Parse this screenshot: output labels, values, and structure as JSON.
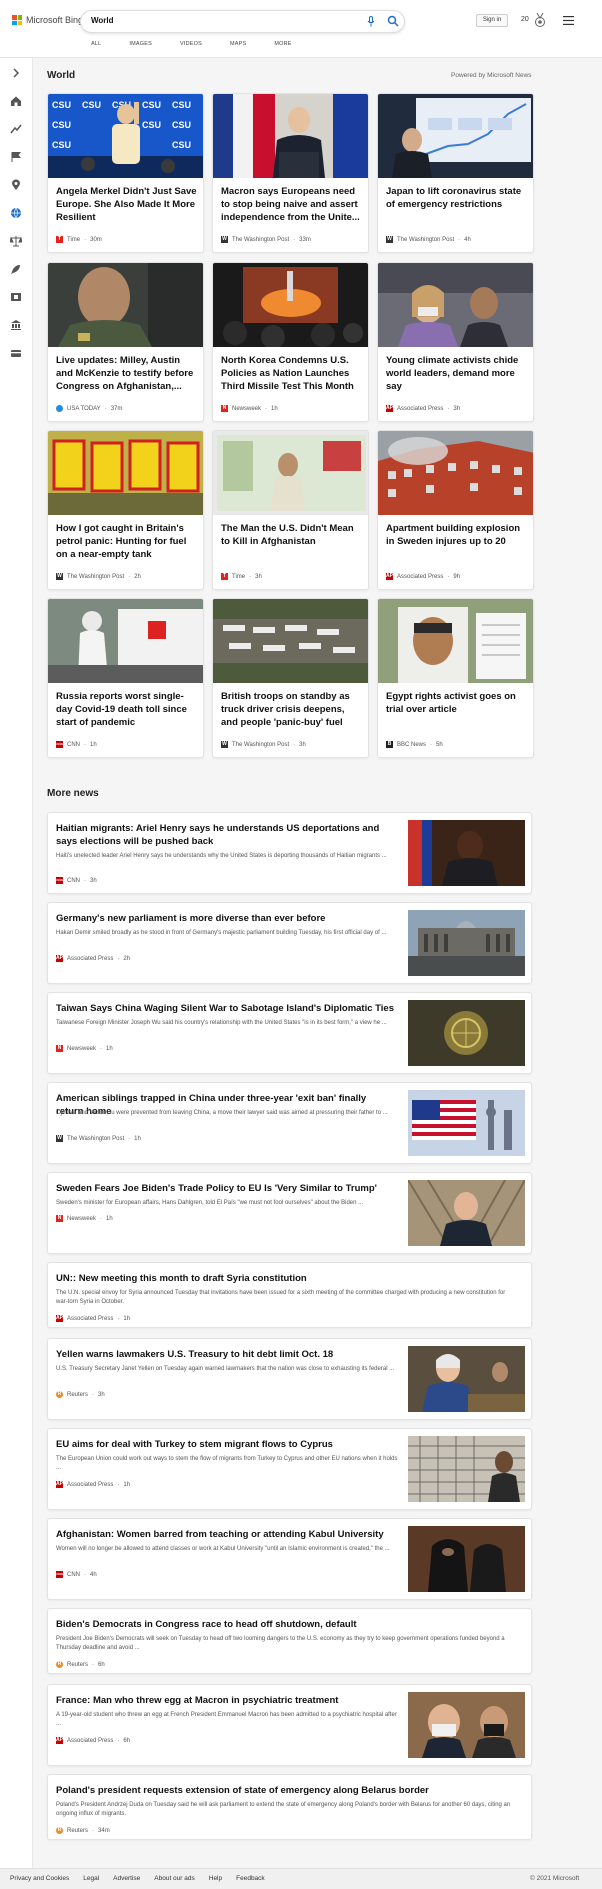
{
  "header": {
    "logo_text": "Microsoft Bing",
    "search_value": "World",
    "tabs": [
      "ALL",
      "IMAGES",
      "VIDEOS",
      "MAPS",
      "MORE"
    ],
    "signin_label": "Sign in",
    "points": "20"
  },
  "sidebar": {
    "icons": [
      "chevron-right-icon",
      "home-icon",
      "trending-icon",
      "flag-icon",
      "location-pin-icon",
      "globe-icon",
      "balance-icon",
      "rocket-icon",
      "film-icon",
      "bank-icon",
      "wallet-icon"
    ]
  },
  "world": {
    "title": "World",
    "powered_by": "Powered by Microsoft News",
    "cards": [
      {
        "title": "Angela Merkel Didn't Just Save Europe. She Also Made It More Resilient",
        "source": "Time",
        "time": "30m",
        "logo": "T",
        "logo_color": "#e2231a"
      },
      {
        "title": "Macron says Europeans need to stop being naive and assert independence from the Unite...",
        "source": "The Washington Post",
        "time": "33m",
        "logo": "W",
        "logo_color": "#333333"
      },
      {
        "title": "Japan to lift coronavirus state of emergency restrictions",
        "source": "The Washington Post",
        "time": "4h",
        "logo": "W",
        "logo_color": "#333333"
      },
      {
        "title": "Live updates: Milley, Austin and McKenzie to testify before Congress on Afghanistan,...",
        "source": "USA TODAY",
        "time": "37m",
        "logo": "●",
        "logo_color": "#1e8fe1"
      },
      {
        "title": "North Korea Condemns U.S. Policies as Nation Launches Third Missile Test This Month",
        "source": "Newsweek",
        "time": "1h",
        "logo": "N",
        "logo_color": "#e2231a"
      },
      {
        "title": "Young climate activists chide world leaders, demand more say",
        "source": "Associated Press",
        "time": "3h",
        "logo": "AP",
        "logo_color": "#cc0000"
      },
      {
        "title": "How I got caught in Britain's petrol panic: Hunting for fuel on a near-empty tank",
        "source": "The Washington Post",
        "time": "2h",
        "logo": "W",
        "logo_color": "#333333"
      },
      {
        "title": "The Man the U.S. Didn't Mean to Kill in Afghanistan",
        "source": "Time",
        "time": "3h",
        "logo": "T",
        "logo_color": "#e2231a"
      },
      {
        "title": "Apartment building explosion in Sweden injures up to 20",
        "source": "Associated Press",
        "time": "9h",
        "logo": "AP",
        "logo_color": "#cc0000"
      },
      {
        "title": "Russia reports worst single-day Covid-19 death toll since start of pandemic",
        "source": "CNN",
        "time": "1h",
        "logo": "CNN",
        "logo_color": "#cc0000"
      },
      {
        "title": "British troops on standby as truck driver crisis deepens, and people 'panic-buy' fuel",
        "source": "The Washington Post",
        "time": "3h",
        "logo": "W",
        "logo_color": "#333333"
      },
      {
        "title": "Egypt rights activist goes on trial over article",
        "source": "BBC News",
        "time": "5h",
        "logo": "B",
        "logo_color": "#222222"
      }
    ]
  },
  "more_news": {
    "title": "More news",
    "items": [
      {
        "title": "Haitian migrants: Ariel Henry says he understands US deportations and says elections will be pushed back",
        "snippet": "Haiti's unelected leader Ariel Henry says he understands why the United States is deporting thousands of Haitian migrants ...",
        "source": "CNN",
        "time": "3h",
        "logo": "CNN",
        "logo_color": "#cc0000"
      },
      {
        "title": "Germany's new parliament is more diverse than ever before",
        "snippet": "Hakan Demir smiled broadly as he stood in front of Germany's majestic parliament building Tuesday, his first official day of ...",
        "source": "Associated Press",
        "time": "2h",
        "logo": "AP",
        "logo_color": "#cc0000"
      },
      {
        "title": "Taiwan Says China Waging Silent War to Sabotage Island's Diplomatic Ties",
        "snippet": "Taiwanese Foreign Minister Joseph Wu said his country's relationship with the United States \"is in its best form,\" a view he ...",
        "source": "Newsweek",
        "time": "1h",
        "logo": "N",
        "logo_color": "#e2231a"
      },
      {
        "title": "American siblings trapped in China under three-year 'exit ban' finally return home",
        "snippet": "Cynthia and Victor Liu were prevented from leaving China, a move their lawyer said was aimed at pressuring their father to ...",
        "source": "The Washington Post",
        "time": "1h",
        "logo": "W",
        "logo_color": "#333333"
      },
      {
        "title": "Sweden Fears Joe Biden's Trade Policy to EU Is 'Very Similar to Trump'",
        "snippet": "Sweden's minister for European affairs, Hans Dahlgren, told El País \"we must not fool ourselves\" about the Biden ...",
        "source": "Newsweek",
        "time": "1h",
        "logo": "N",
        "logo_color": "#e2231a"
      },
      {
        "title": "UN:: New meeting this month to draft Syria constitution",
        "snippet": "The U.N. special envoy for Syria announced Tuesday that invitations have been issued for a sixth meeting of the committee charged with producing a new constitution for war-torn Syria in October.",
        "source": "Associated Press",
        "time": "1h",
        "logo": "AP",
        "logo_color": "#cc0000"
      },
      {
        "title": "Yellen warns lawmakers U.S. Treasury to hit debt limit Oct. 18",
        "snippet": "U.S. Treasury Secretary Janet Yellen on Tuesday again warned lawmakers that the nation was close to exhausting its federal ...",
        "source": "Reuters",
        "time": "3h",
        "logo": "R",
        "logo_color": "#f08a24"
      },
      {
        "title": "EU aims for deal with Turkey to stem migrant flows to Cyprus",
        "snippet": "The European Union could work out ways to stem the flow of migrants from Turkey to Cyprus and other EU nations when it holds ...",
        "source": "Associated Press",
        "time": "1h",
        "logo": "AP",
        "logo_color": "#cc0000"
      },
      {
        "title": "Afghanistan: Women barred from teaching or attending Kabul University",
        "snippet": "Women will no longer be allowed to attend classes or work at Kabul University \"until an Islamic environment is created,\" the ...",
        "source": "CNN",
        "time": "4h",
        "logo": "CNN",
        "logo_color": "#cc0000"
      },
      {
        "title": "Biden's Democrats in Congress race to head off shutdown, default",
        "snippet": "President Joe Biden's Democrats will seek on Tuesday to head off two looming dangers to the U.S. economy as they try to keep government operations funded beyond a Thursday deadline and avoid ...",
        "source": "Reuters",
        "time": "6h",
        "logo": "R",
        "logo_color": "#f08a24"
      },
      {
        "title": "France: Man who threw egg at Macron in psychiatric treatment",
        "snippet": "A 19-year-old student who threw an egg at French President Emmanuel Macron has been admitted to a psychiatric hospital after ...",
        "source": "Associated Press",
        "time": "6h",
        "logo": "AP",
        "logo_color": "#cc0000"
      },
      {
        "title": "Poland's president requests extension of state of emergency along Belarus border",
        "snippet": "Poland's President Andrzej Duda on Tuesday said he will ask parliament to extend the state of emergency along Poland's border with Belarus for another 60 days, citing an ongoing influx of migrants.",
        "source": "Reuters",
        "time": "34m",
        "logo": "R",
        "logo_color": "#f08a24"
      }
    ]
  },
  "footer": {
    "links": [
      "Privacy and Cookies",
      "Legal",
      "Advertise",
      "About our ads",
      "Help",
      "Feedback"
    ],
    "copyright": "© 2021 Microsoft"
  }
}
